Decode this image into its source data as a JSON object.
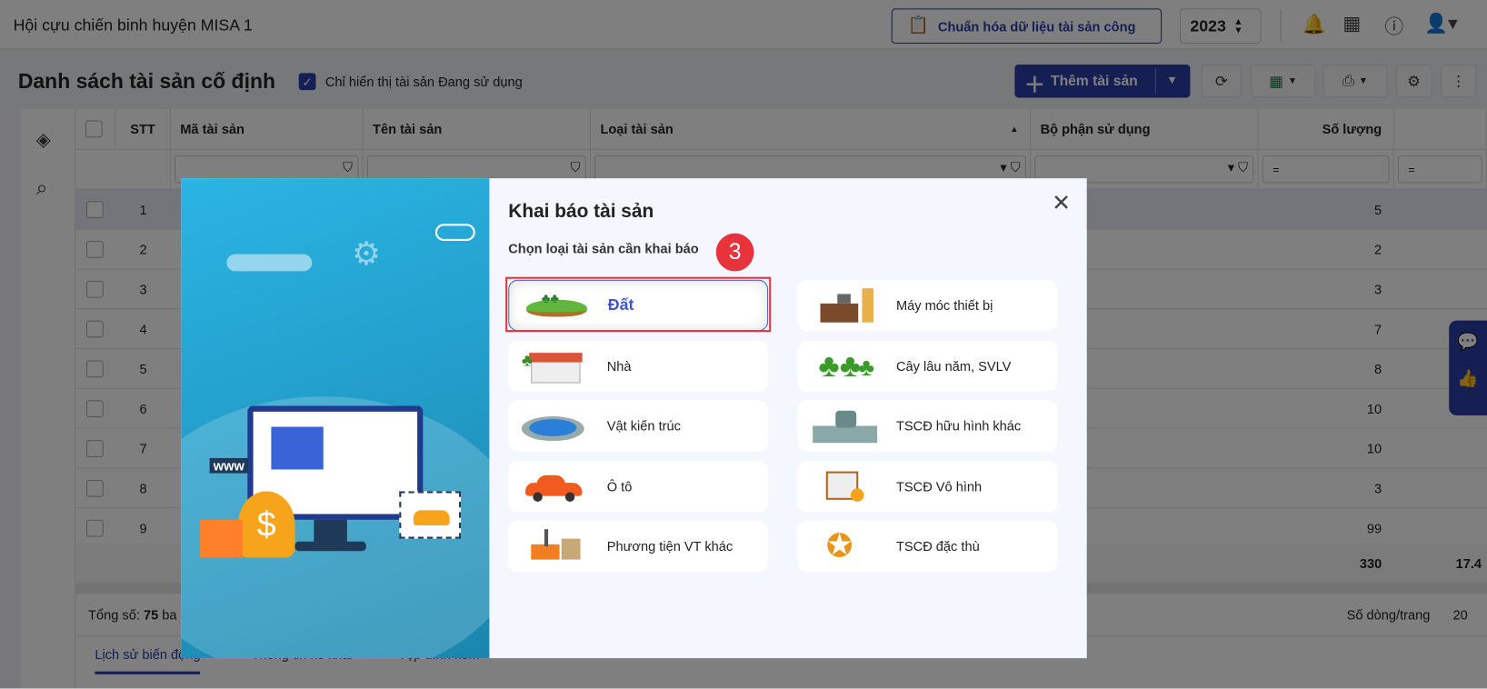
{
  "topbar": {
    "app_title": "Hội cựu chiến binh huyện MISA 1",
    "standardize_button": "Chuẩn hóa dữ liệu tài sản công",
    "year": "2023"
  },
  "page": {
    "title": "Danh sách tài sản cố định",
    "filter_checkbox_label": "Chỉ hiển thị tài sản Đang sử dụng",
    "add_button": "Thêm tài sản"
  },
  "table": {
    "columns": [
      "STT",
      "Mã tài sản",
      "Tên tài sản",
      "Loại tài sản",
      "Bộ phận sử dụng",
      "Số lượng"
    ],
    "rows": [
      {
        "stt": "1",
        "qty": "5"
      },
      {
        "stt": "2",
        "qty": "2"
      },
      {
        "stt": "3",
        "qty": "3"
      },
      {
        "stt": "4",
        "qty": "7"
      },
      {
        "stt": "5",
        "qty": "8"
      },
      {
        "stt": "6",
        "qty": "10"
      },
      {
        "stt": "7",
        "qty": "10"
      },
      {
        "stt": "8",
        "qty": "3"
      },
      {
        "stt": "9",
        "qty": "99"
      }
    ],
    "total_qty": "330",
    "total_next": "17.4",
    "filter_eq": "="
  },
  "footer": {
    "total_label": "Tổng số:",
    "total_value": "75",
    "total_suffix": "ba",
    "page_size_label": "Số dòng/trang",
    "page_size": "20"
  },
  "bottom_tabs": [
    "Lịch sử biến động",
    "Thông tin kê khai",
    "Tệp đính kèm"
  ],
  "modal": {
    "title": "Khai báo tài sản",
    "subtitle": "Chọn loại tài sản cần khai báo",
    "step_badge": "3",
    "options": [
      "Đất",
      "Máy móc thiết bị",
      "Nhà",
      "Cây lâu năm, SVLV",
      "Vật kiến trúc",
      "TSCĐ hữu hình khác",
      "Ô tô",
      "TSCĐ Vô hình",
      "Phương tiện VT khác",
      "TSCĐ đặc thù"
    ],
    "selected": "Đất",
    "illustration_text": "www"
  }
}
